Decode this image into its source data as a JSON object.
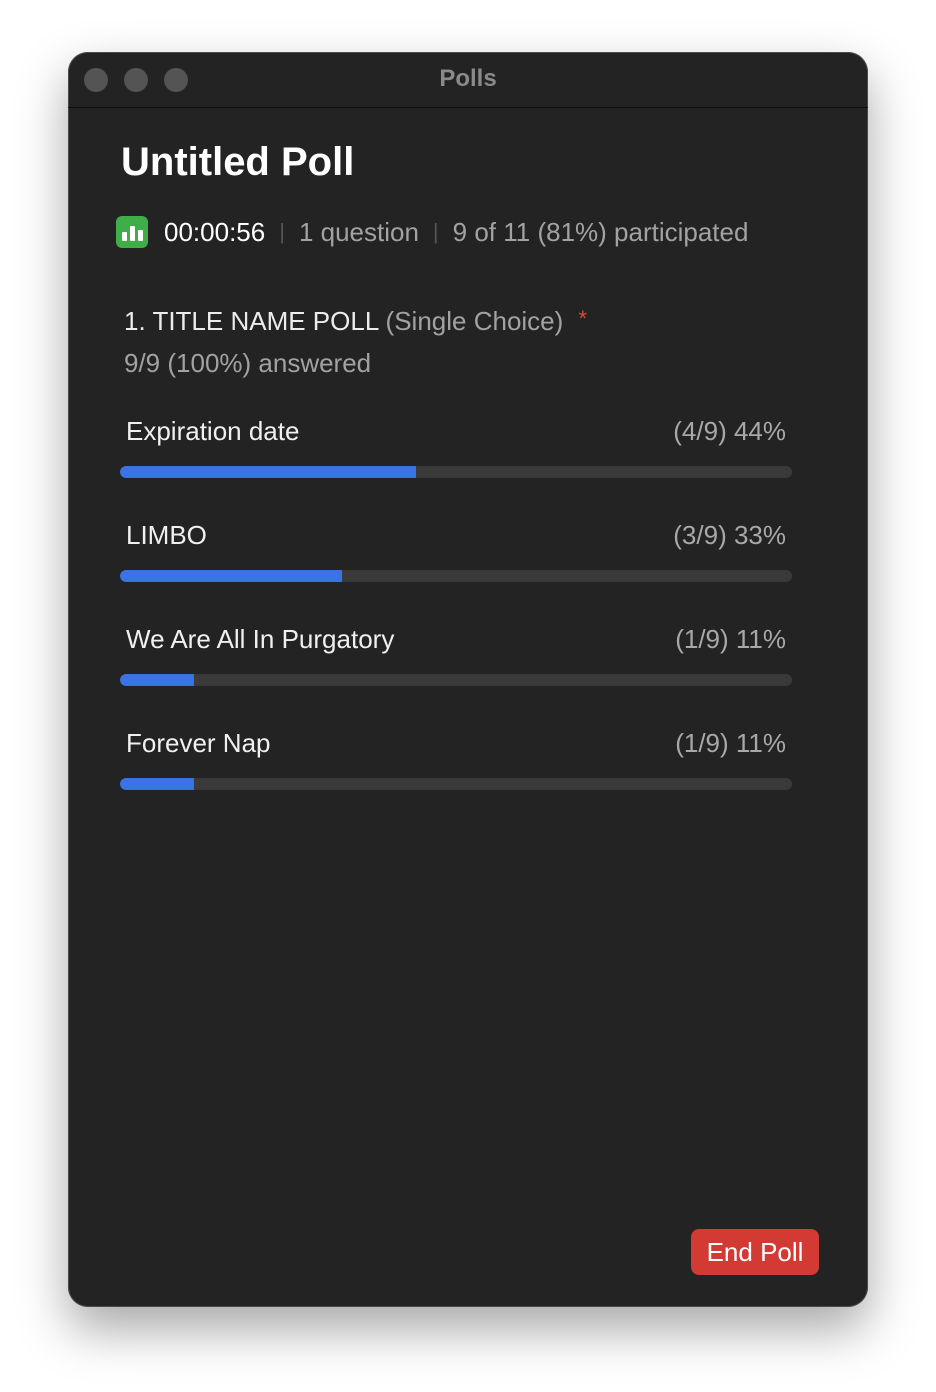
{
  "window": {
    "title": "Polls"
  },
  "poll": {
    "title": "Untitled Poll",
    "elapsed": "00:00:56",
    "question_count": "1 question",
    "participation": "9 of 11 (81%) participated"
  },
  "question": {
    "text": "1. TITLE NAME POLL",
    "type": "(Single Choice)",
    "required_mark": "*",
    "answered": "9/9 (100%) answered"
  },
  "options": [
    {
      "label": "Expiration date",
      "stat": "(4/9) 44%",
      "fraction": 0.44
    },
    {
      "label": "LIMBO",
      "stat": "(3/9) 33%",
      "fraction": 0.33
    },
    {
      "label": "We Are All In Purgatory",
      "stat": "(1/9) 11%",
      "fraction": 0.11
    },
    {
      "label": "Forever Nap",
      "stat": "(1/9) 11%",
      "fraction": 0.11
    }
  ],
  "actions": {
    "end_poll": "End Poll"
  },
  "icons": {
    "stats_icon": "bar-chart-icon"
  },
  "colors": {
    "bar_fill": "#3a73e3",
    "end_button": "#d23a33",
    "stats_badge": "#3fae49"
  }
}
